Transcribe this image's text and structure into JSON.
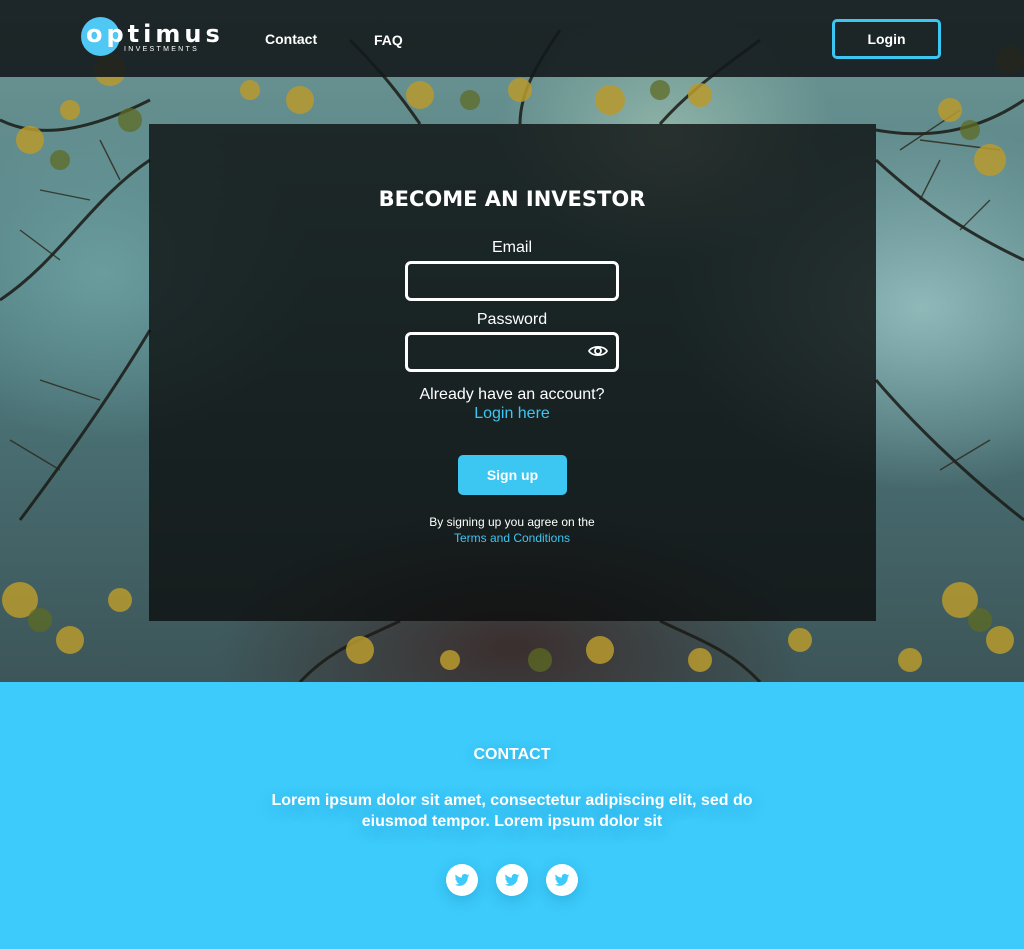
{
  "header": {
    "logo_word": "optimus",
    "logo_sub": "INVESTMENTS",
    "nav": {
      "contact": "Contact",
      "faq": "FAQ"
    },
    "login_label": "Login"
  },
  "signup": {
    "title": "BECOME AN INVESTOR",
    "email_label": "Email",
    "email_value": "",
    "password_label": "Password",
    "password_value": "",
    "already_text": "Already have an account?",
    "login_link": "Login here",
    "signup_button": "Sign up",
    "terms_text": "By signing up you agree on the",
    "terms_link": "Terms and Conditions"
  },
  "contact": {
    "title": "CONTACT",
    "body": "Lorem ipsum dolor sit amet, consectetur adipiscing elit, sed do eiusmod tempor. Lorem ipsum dolor sit",
    "socials": [
      "twitter-icon",
      "twitter-icon",
      "twitter-icon"
    ]
  },
  "colors": {
    "accent": "#3cc6f2",
    "contact_bg": "#3ccbfb",
    "header_bg": "#141a1c",
    "card_bg": "#0a0c0c"
  }
}
